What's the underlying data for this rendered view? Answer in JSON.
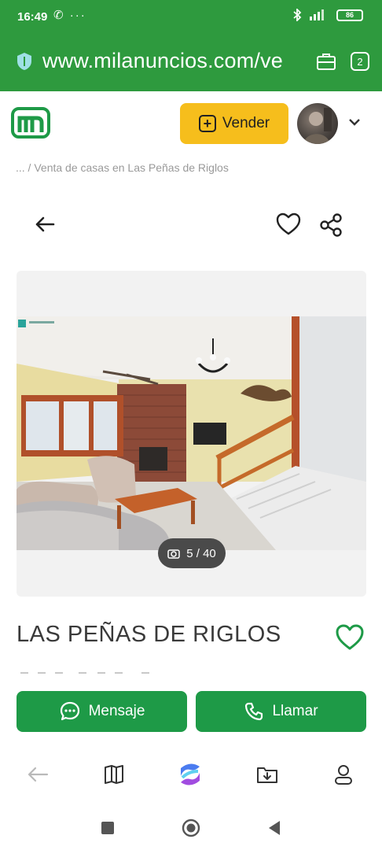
{
  "status_bar": {
    "time": "16:49",
    "left_icons": "✆ ···",
    "battery": "86"
  },
  "browser": {
    "url": "www.milanuncios.com/ve",
    "tab_count": "2"
  },
  "header": {
    "sell_label": "Vender",
    "sell_icon": "plus-square-icon",
    "logo_letter": "m"
  },
  "breadcrumb": "... / Venta de casas en Las Peñas de Riglos",
  "gallery": {
    "counter": "5 / 40",
    "current_photo": 5,
    "total_photos": 40
  },
  "listing": {
    "title": "LAS PEÑAS DE RIGLOS"
  },
  "actions": {
    "message_label": "Mensaje",
    "call_label": "Llamar"
  },
  "colors": {
    "brand_green": "#2e9a3e",
    "button_green": "#1e9a47",
    "sell_yellow": "#f6be1c"
  },
  "bottom_nav": [
    "back-icon",
    "book-icon",
    "browser-logo-icon",
    "download-folder-icon",
    "profile-icon"
  ],
  "system_nav": [
    "recent-apps-icon",
    "home-icon",
    "back-triangle-icon"
  ]
}
